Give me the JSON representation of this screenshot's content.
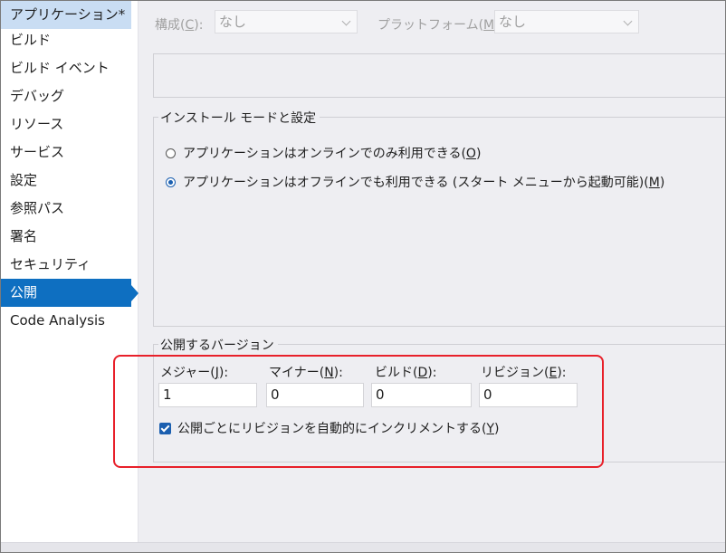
{
  "sidebar": {
    "items": [
      {
        "label": "アプリケーション*"
      },
      {
        "label": "ビルド"
      },
      {
        "label": "ビルド イベント"
      },
      {
        "label": "デバッグ"
      },
      {
        "label": "リソース"
      },
      {
        "label": "サービス"
      },
      {
        "label": "設定"
      },
      {
        "label": "参照パス"
      },
      {
        "label": "署名"
      },
      {
        "label": "セキュリティ"
      },
      {
        "label": "公開"
      },
      {
        "label": "Code Analysis"
      }
    ],
    "active": "公開"
  },
  "toolbar": {
    "configuration_label": "構成(",
    "configuration_key": "C",
    "configuration_tail": "):",
    "configuration_value": "なし",
    "platform_label": "プラットフォーム(",
    "platform_key": "M",
    "platform_tail": "):",
    "platform_value": "なし"
  },
  "install_mode": {
    "title": "インストール モードと設定",
    "online_option": {
      "text": "アプリケーションはオンラインでのみ利用できる(",
      "key": "O",
      "tail": ")"
    },
    "offline_option": {
      "text": "アプリケーションはオフラインでも利用できる (スタート メニューから起動可能)(",
      "key": "M",
      "tail": ")"
    },
    "selected": "offline"
  },
  "publish_version": {
    "title": "公開するバージョン",
    "major": {
      "label": "メジャー(",
      "key": "J",
      "tail": "):",
      "value": "1"
    },
    "minor": {
      "label": "マイナー(",
      "key": "N",
      "tail": "):",
      "value": "0"
    },
    "build": {
      "label": "ビルド(",
      "key": "D",
      "tail": "):",
      "value": "0"
    },
    "revision": {
      "label": "リビジョン(",
      "key": "E",
      "tail": "):",
      "value": "0"
    },
    "auto_increment": {
      "text": "公開ごとにリビジョンを自動的にインクリメントする(",
      "key": "Y",
      "tail": ")",
      "checked": true
    }
  },
  "colors": {
    "accent": "#0e6fc1",
    "highlight_border": "#e8202a"
  }
}
